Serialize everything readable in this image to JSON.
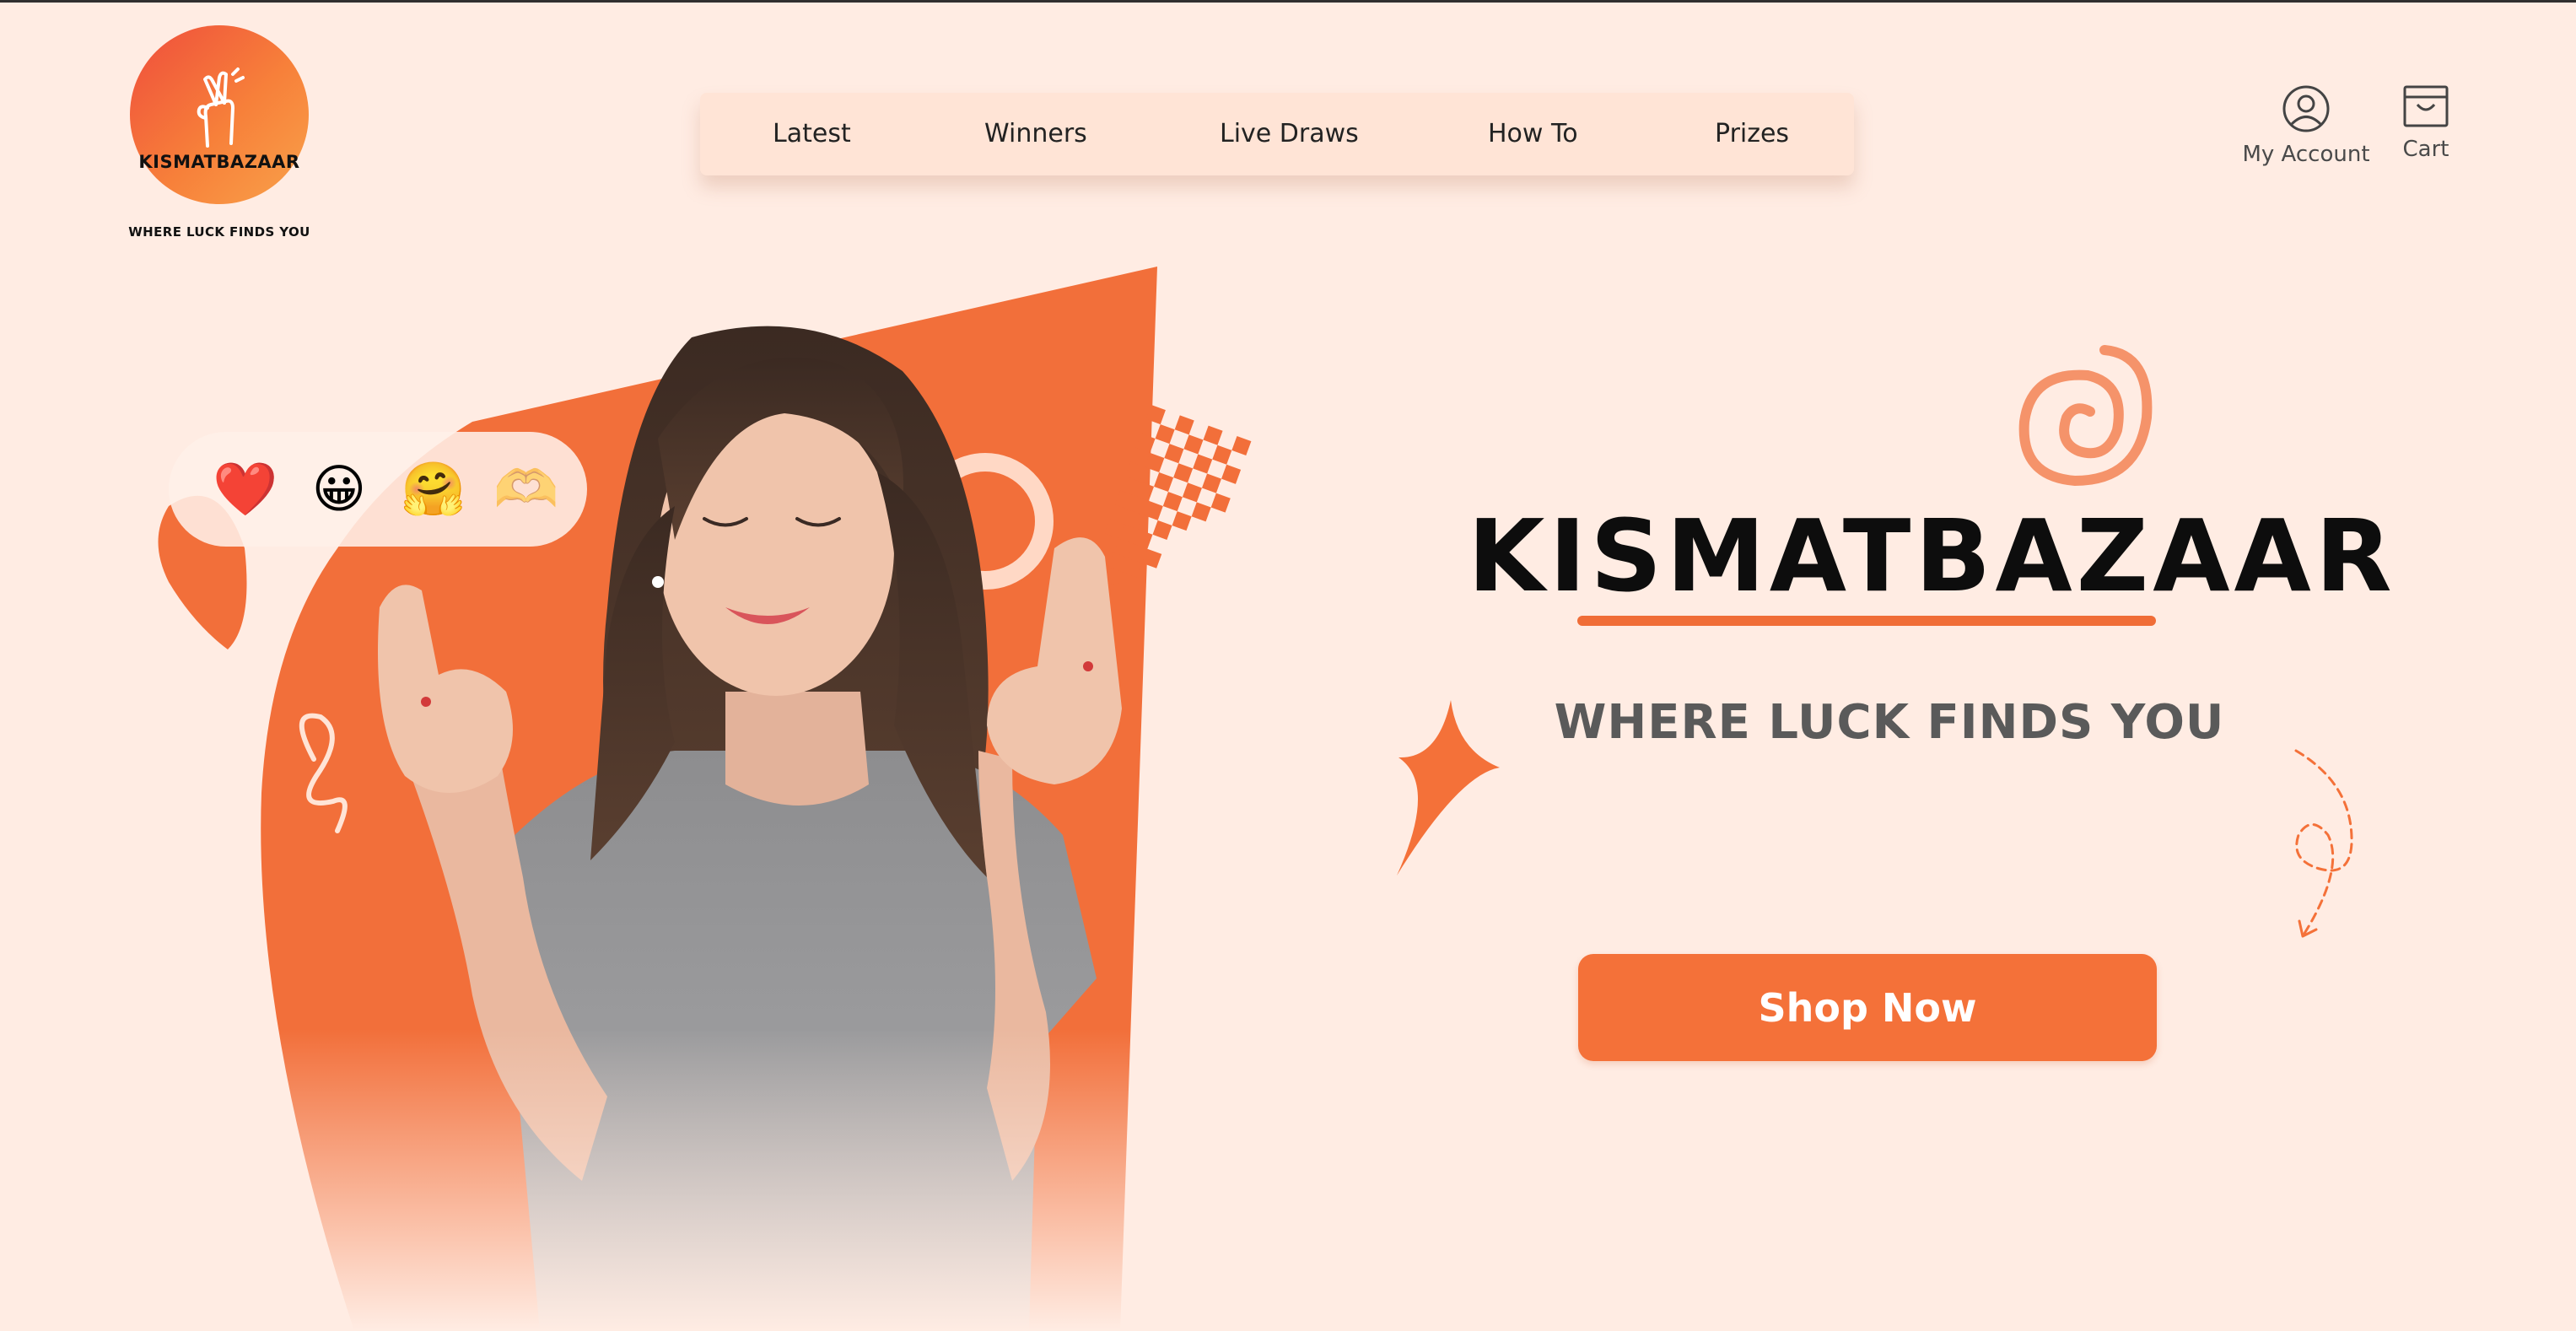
{
  "header": {
    "logo": {
      "name": "KISMATBAZAAR",
      "tagline": "WHERE LUCK FINDS YOU"
    },
    "nav": [
      {
        "label": "Latest"
      },
      {
        "label": "Winners"
      },
      {
        "label": "Live Draws"
      },
      {
        "label": "How To"
      },
      {
        "label": "Prizes"
      }
    ],
    "account_label": "My Account",
    "cart_label": "Cart"
  },
  "hero": {
    "reactions": [
      "❤️",
      "😀",
      "🤗",
      "🫶"
    ],
    "title": "KISMATBAZAAR",
    "tagline": "WHERE LUCK FINDS YOU",
    "cta_label": "Shop Now"
  },
  "colors": {
    "background": "#ffece3",
    "accent": "#f47139",
    "nav_bg": "#ffe4d6",
    "title_text": "#0d0d0d"
  },
  "icons": [
    "crossed-fingers-logo-icon",
    "user-circle-icon",
    "shopping-bag-icon"
  ]
}
